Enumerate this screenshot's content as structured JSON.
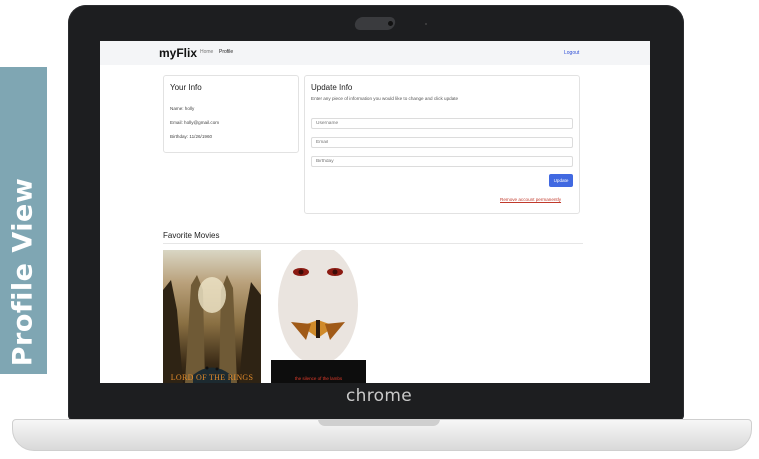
{
  "side_banner": {
    "text": "Profile View"
  },
  "device": {
    "brand": "chrome"
  },
  "navbar": {
    "brand": "myFlix",
    "links": [
      "Home",
      "Profile"
    ],
    "logout": "Logout"
  },
  "your_info": {
    "title": "Your Info",
    "name": "Name: holly",
    "email": "Email: holly@gmail.com",
    "birthday": "Birthday: 11/26/1960"
  },
  "update_info": {
    "title": "Update Info",
    "description": "Enter any piece of information you would like to change and click update",
    "fields": [
      {
        "placeholder": "Username"
      },
      {
        "placeholder": "Email"
      },
      {
        "placeholder": "Birthday"
      }
    ],
    "button": "Update",
    "remove_link": "Remove account permanently"
  },
  "favorites": {
    "title": "Favorite Movies",
    "movies": [
      {
        "poster_title": "LORD OF THE RINGS"
      },
      {
        "poster_title": "the silence of the lambs"
      }
    ]
  },
  "colors": {
    "banner": "#7fa6b3",
    "accent": "#4169e1",
    "danger": "#c0392b"
  }
}
